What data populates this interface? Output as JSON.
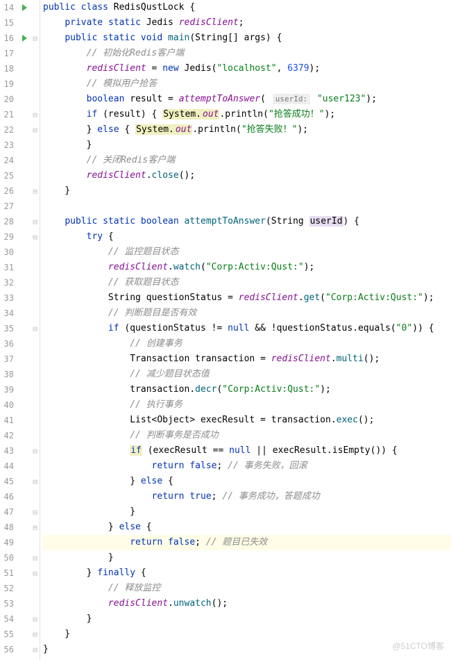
{
  "watermark": "@51CTO博客",
  "lines": [
    {
      "n": "14",
      "run": true,
      "fold": false,
      "hl": false,
      "tokens": [
        {
          "t": "public",
          "c": "kw"
        },
        {
          "t": " "
        },
        {
          "t": "class",
          "c": "kw"
        },
        {
          "t": " "
        },
        {
          "t": "RedisQustLock",
          "c": "cls"
        },
        {
          "t": " {"
        }
      ]
    },
    {
      "n": "15",
      "run": false,
      "fold": false,
      "hl": false,
      "tokens": [
        {
          "t": "    "
        },
        {
          "t": "private",
          "c": "kw"
        },
        {
          "t": " "
        },
        {
          "t": "static",
          "c": "kw"
        },
        {
          "t": " "
        },
        {
          "t": "Jedis",
          "c": "cls"
        },
        {
          "t": " "
        },
        {
          "t": "redisClient",
          "c": "field"
        },
        {
          "t": ";"
        }
      ]
    },
    {
      "n": "16",
      "run": true,
      "fold": true,
      "hl": false,
      "tokens": [
        {
          "t": "    "
        },
        {
          "t": "public",
          "c": "kw"
        },
        {
          "t": " "
        },
        {
          "t": "static",
          "c": "kw"
        },
        {
          "t": " "
        },
        {
          "t": "void",
          "c": "kw"
        },
        {
          "t": " "
        },
        {
          "t": "main",
          "c": "mth"
        },
        {
          "t": "(String[] args) {"
        }
      ]
    },
    {
      "n": "17",
      "run": false,
      "fold": false,
      "hl": false,
      "tokens": [
        {
          "t": "        "
        },
        {
          "t": "// 初始化Redis客户端",
          "c": "cmt"
        }
      ]
    },
    {
      "n": "18",
      "run": false,
      "fold": false,
      "hl": false,
      "tokens": [
        {
          "t": "        "
        },
        {
          "t": "redisClient",
          "c": "field"
        },
        {
          "t": " = "
        },
        {
          "t": "new",
          "c": "kw"
        },
        {
          "t": " Jedis("
        },
        {
          "t": "\"localhost\"",
          "c": "str"
        },
        {
          "t": ", "
        },
        {
          "t": "6379",
          "c": "num"
        },
        {
          "t": ");"
        }
      ]
    },
    {
      "n": "19",
      "run": false,
      "fold": false,
      "hl": false,
      "tokens": [
        {
          "t": "        "
        },
        {
          "t": "// 模拟用户抢答",
          "c": "cmt"
        }
      ]
    },
    {
      "n": "20",
      "run": false,
      "fold": false,
      "hl": false,
      "tokens": [
        {
          "t": "        "
        },
        {
          "t": "boolean",
          "c": "kw"
        },
        {
          "t": " result = "
        },
        {
          "t": "attemptToAnswer",
          "c": "ital"
        },
        {
          "t": "( "
        },
        {
          "t": "userId:",
          "hint": true
        },
        {
          "t": " "
        },
        {
          "t": "\"user123\"",
          "c": "str"
        },
        {
          "t": ");"
        }
      ]
    },
    {
      "n": "21",
      "run": false,
      "fold": true,
      "hl": false,
      "tokens": [
        {
          "t": "        "
        },
        {
          "t": "if",
          "c": "kw"
        },
        {
          "t": " (result) { "
        },
        {
          "t": "System.",
          "c": "bg-method"
        },
        {
          "t": "out",
          "c": "ital bg-method"
        },
        {
          "t": ".println("
        },
        {
          "t": "\"抢答成功！\"",
          "c": "str"
        },
        {
          "t": ");"
        }
      ]
    },
    {
      "n": "22",
      "run": false,
      "fold": true,
      "hl": false,
      "tokens": [
        {
          "t": "        } "
        },
        {
          "t": "else",
          "c": "kw"
        },
        {
          "t": " { "
        },
        {
          "t": "System.",
          "c": "bg-method"
        },
        {
          "t": "out",
          "c": "ital bg-method"
        },
        {
          "t": ".println("
        },
        {
          "t": "\"抢答失败！\"",
          "c": "str"
        },
        {
          "t": ");"
        }
      ]
    },
    {
      "n": "23",
      "run": false,
      "fold": false,
      "hl": false,
      "tokens": [
        {
          "t": "        }"
        }
      ]
    },
    {
      "n": "24",
      "run": false,
      "fold": false,
      "hl": false,
      "tokens": [
        {
          "t": "        "
        },
        {
          "t": "// 关闭Redis客户端",
          "c": "cmt"
        }
      ]
    },
    {
      "n": "25",
      "run": false,
      "fold": false,
      "hl": false,
      "tokens": [
        {
          "t": "        "
        },
        {
          "t": "redisClient",
          "c": "field"
        },
        {
          "t": "."
        },
        {
          "t": "close",
          "c": "mth"
        },
        {
          "t": "();"
        }
      ]
    },
    {
      "n": "26",
      "run": false,
      "fold": true,
      "hl": false,
      "tokens": [
        {
          "t": "    }"
        }
      ]
    },
    {
      "n": "27",
      "run": false,
      "fold": false,
      "hl": false,
      "tokens": []
    },
    {
      "n": "28",
      "run": false,
      "fold": true,
      "hl": false,
      "tokens": [
        {
          "t": "    "
        },
        {
          "t": "public",
          "c": "kw"
        },
        {
          "t": " "
        },
        {
          "t": "static",
          "c": "kw"
        },
        {
          "t": " "
        },
        {
          "t": "boolean",
          "c": "kw"
        },
        {
          "t": " "
        },
        {
          "t": "attemptToAnswer",
          "c": "mth"
        },
        {
          "t": "(String "
        },
        {
          "t": "userId",
          "c": "bg-param"
        },
        {
          "t": ") {"
        }
      ]
    },
    {
      "n": "29",
      "run": false,
      "fold": true,
      "hl": false,
      "tokens": [
        {
          "t": "        "
        },
        {
          "t": "try",
          "c": "kw"
        },
        {
          "t": " {"
        }
      ]
    },
    {
      "n": "30",
      "run": false,
      "fold": false,
      "hl": false,
      "tokens": [
        {
          "t": "            "
        },
        {
          "t": "// 监控题目状态",
          "c": "cmt"
        }
      ]
    },
    {
      "n": "31",
      "run": false,
      "fold": false,
      "hl": false,
      "tokens": [
        {
          "t": "            "
        },
        {
          "t": "redisClient",
          "c": "field"
        },
        {
          "t": "."
        },
        {
          "t": "watch",
          "c": "mth"
        },
        {
          "t": "("
        },
        {
          "t": "\"Corp:Activ:Qust:\"",
          "c": "str"
        },
        {
          "t": ");"
        }
      ]
    },
    {
      "n": "32",
      "run": false,
      "fold": false,
      "hl": false,
      "tokens": [
        {
          "t": "            "
        },
        {
          "t": "// 获取题目状态",
          "c": "cmt"
        }
      ]
    },
    {
      "n": "33",
      "run": false,
      "fold": false,
      "hl": false,
      "tokens": [
        {
          "t": "            String questionStatus = "
        },
        {
          "t": "redisClient",
          "c": "field"
        },
        {
          "t": "."
        },
        {
          "t": "get",
          "c": "mth"
        },
        {
          "t": "("
        },
        {
          "t": "\"Corp:Activ:Qust:\"",
          "c": "str"
        },
        {
          "t": ");"
        }
      ]
    },
    {
      "n": "34",
      "run": false,
      "fold": false,
      "hl": false,
      "tokens": [
        {
          "t": "            "
        },
        {
          "t": "// 判断题目是否有效",
          "c": "cmt"
        }
      ]
    },
    {
      "n": "35",
      "run": false,
      "fold": true,
      "hl": false,
      "tokens": [
        {
          "t": "            "
        },
        {
          "t": "if",
          "c": "kw"
        },
        {
          "t": " (questionStatus != "
        },
        {
          "t": "null",
          "c": "kw"
        },
        {
          "t": " && !questionStatus.equals("
        },
        {
          "t": "\"0\"",
          "c": "str"
        },
        {
          "t": ")) {"
        }
      ]
    },
    {
      "n": "36",
      "run": false,
      "fold": false,
      "hl": false,
      "tokens": [
        {
          "t": "                "
        },
        {
          "t": "// 创建事务",
          "c": "cmt"
        }
      ]
    },
    {
      "n": "37",
      "run": false,
      "fold": false,
      "hl": false,
      "tokens": [
        {
          "t": "                "
        },
        {
          "t": "Transaction",
          "c": "cls"
        },
        {
          "t": " transaction = "
        },
        {
          "t": "redisClient",
          "c": "field"
        },
        {
          "t": "."
        },
        {
          "t": "multi",
          "c": "mth"
        },
        {
          "t": "();"
        }
      ]
    },
    {
      "n": "38",
      "run": false,
      "fold": false,
      "hl": false,
      "tokens": [
        {
          "t": "                "
        },
        {
          "t": "// 减少题目状态值",
          "c": "cmt"
        }
      ]
    },
    {
      "n": "39",
      "run": false,
      "fold": false,
      "hl": false,
      "tokens": [
        {
          "t": "                transaction."
        },
        {
          "t": "decr",
          "c": "mth"
        },
        {
          "t": "("
        },
        {
          "t": "\"Corp:Activ:Qust:\"",
          "c": "str"
        },
        {
          "t": ");"
        }
      ]
    },
    {
      "n": "40",
      "run": false,
      "fold": false,
      "hl": false,
      "tokens": [
        {
          "t": "                "
        },
        {
          "t": "// 执行事务",
          "c": "cmt"
        }
      ]
    },
    {
      "n": "41",
      "run": false,
      "fold": false,
      "hl": false,
      "tokens": [
        {
          "t": "                List<Object> execResult = transaction."
        },
        {
          "t": "exec",
          "c": "mth"
        },
        {
          "t": "();"
        }
      ]
    },
    {
      "n": "42",
      "run": false,
      "fold": false,
      "hl": false,
      "tokens": [
        {
          "t": "                "
        },
        {
          "t": "// 判断事务是否成功",
          "c": "cmt"
        }
      ]
    },
    {
      "n": "43",
      "run": false,
      "fold": true,
      "hl": false,
      "tokens": [
        {
          "t": "                "
        },
        {
          "t": "if",
          "c": "kw bg-method"
        },
        {
          "t": " (execResult == "
        },
        {
          "t": "null",
          "c": "kw"
        },
        {
          "t": " || execResult.isEmpty()) {"
        }
      ]
    },
    {
      "n": "44",
      "run": false,
      "fold": false,
      "hl": false,
      "tokens": [
        {
          "t": "                    "
        },
        {
          "t": "return",
          "c": "kw"
        },
        {
          "t": " "
        },
        {
          "t": "false",
          "c": "kw"
        },
        {
          "t": "; "
        },
        {
          "t": "// 事务失败，回滚",
          "c": "cmt"
        }
      ]
    },
    {
      "n": "45",
      "run": false,
      "fold": true,
      "hl": false,
      "tokens": [
        {
          "t": "                } "
        },
        {
          "t": "else",
          "c": "kw"
        },
        {
          "t": " {"
        }
      ]
    },
    {
      "n": "46",
      "run": false,
      "fold": false,
      "hl": false,
      "tokens": [
        {
          "t": "                    "
        },
        {
          "t": "return",
          "c": "kw"
        },
        {
          "t": " "
        },
        {
          "t": "true",
          "c": "kw"
        },
        {
          "t": "; "
        },
        {
          "t": "// 事务成功，答题成功",
          "c": "cmt"
        }
      ]
    },
    {
      "n": "47",
      "run": false,
      "fold": true,
      "hl": false,
      "tokens": [
        {
          "t": "                }"
        }
      ]
    },
    {
      "n": "48",
      "run": false,
      "fold": true,
      "hl": false,
      "tokens": [
        {
          "t": "            } "
        },
        {
          "t": "else",
          "c": "kw"
        },
        {
          "t": " {"
        }
      ]
    },
    {
      "n": "49",
      "run": false,
      "fold": false,
      "hl": true,
      "tokens": [
        {
          "t": "                "
        },
        {
          "t": "return",
          "c": "kw"
        },
        {
          "t": " "
        },
        {
          "t": "false",
          "c": "kw"
        },
        {
          "t": "; "
        },
        {
          "t": "// 题目已失效",
          "c": "cmt"
        }
      ]
    },
    {
      "n": "50",
      "run": false,
      "fold": true,
      "hl": false,
      "tokens": [
        {
          "t": "            }"
        }
      ]
    },
    {
      "n": "51",
      "run": false,
      "fold": true,
      "hl": false,
      "tokens": [
        {
          "t": "        } "
        },
        {
          "t": "finally",
          "c": "kw"
        },
        {
          "t": " {"
        }
      ]
    },
    {
      "n": "52",
      "run": false,
      "fold": false,
      "hl": false,
      "tokens": [
        {
          "t": "            "
        },
        {
          "t": "// 释放监控",
          "c": "cmt"
        }
      ]
    },
    {
      "n": "53",
      "run": false,
      "fold": false,
      "hl": false,
      "tokens": [
        {
          "t": "            "
        },
        {
          "t": "redisClient",
          "c": "field"
        },
        {
          "t": "."
        },
        {
          "t": "unwatch",
          "c": "mth"
        },
        {
          "t": "();"
        }
      ]
    },
    {
      "n": "54",
      "run": false,
      "fold": true,
      "hl": false,
      "tokens": [
        {
          "t": "        }"
        }
      ]
    },
    {
      "n": "55",
      "run": false,
      "fold": true,
      "hl": false,
      "tokens": [
        {
          "t": "    }"
        }
      ]
    },
    {
      "n": "56",
      "run": false,
      "fold": true,
      "hl": false,
      "tokens": [
        {
          "t": "}"
        }
      ]
    }
  ]
}
